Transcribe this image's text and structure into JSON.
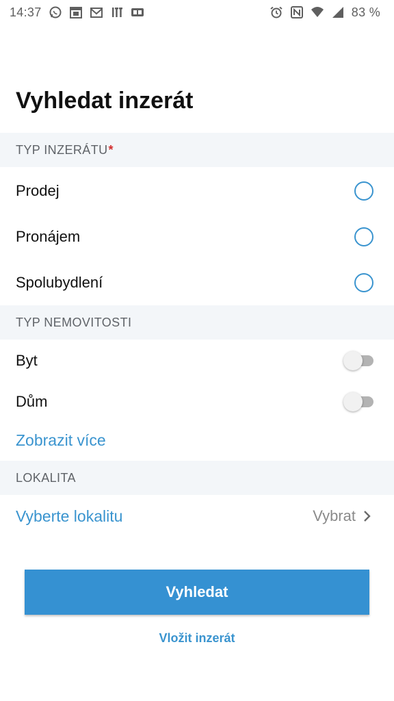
{
  "status_bar": {
    "time": "14:37",
    "battery": "83 %",
    "left_icons": [
      "whatsapp-icon",
      "calendar-icon",
      "gmail-icon",
      "ift-icon",
      "ge-icon"
    ],
    "right_icons": [
      "alarm-icon",
      "nfc-icon",
      "wifi-icon",
      "signal-icon"
    ]
  },
  "page": {
    "title": "Vyhledat inzerát"
  },
  "listing_type": {
    "header": "TYP INZERÁTU",
    "required_mark": "*",
    "options": [
      {
        "label": "Prodej",
        "selected": false
      },
      {
        "label": "Pronájem",
        "selected": false
      },
      {
        "label": "Spolubydlení",
        "selected": false
      }
    ]
  },
  "property_type": {
    "header": "TYP NEMOVITOSTI",
    "options": [
      {
        "label": "Byt",
        "on": false
      },
      {
        "label": "Dům",
        "on": false
      }
    ],
    "show_more": "Zobrazit více"
  },
  "location": {
    "header": "LOKALITA",
    "label": "Vyberte lokalitu",
    "value": "Vybrat"
  },
  "actions": {
    "search": "Vyhledat",
    "post": "Vložit inzerát"
  },
  "colors": {
    "accent": "#3a94cf",
    "button": "#3591d2",
    "section_bg": "#f3f6f9",
    "required": "#d32f2f"
  }
}
